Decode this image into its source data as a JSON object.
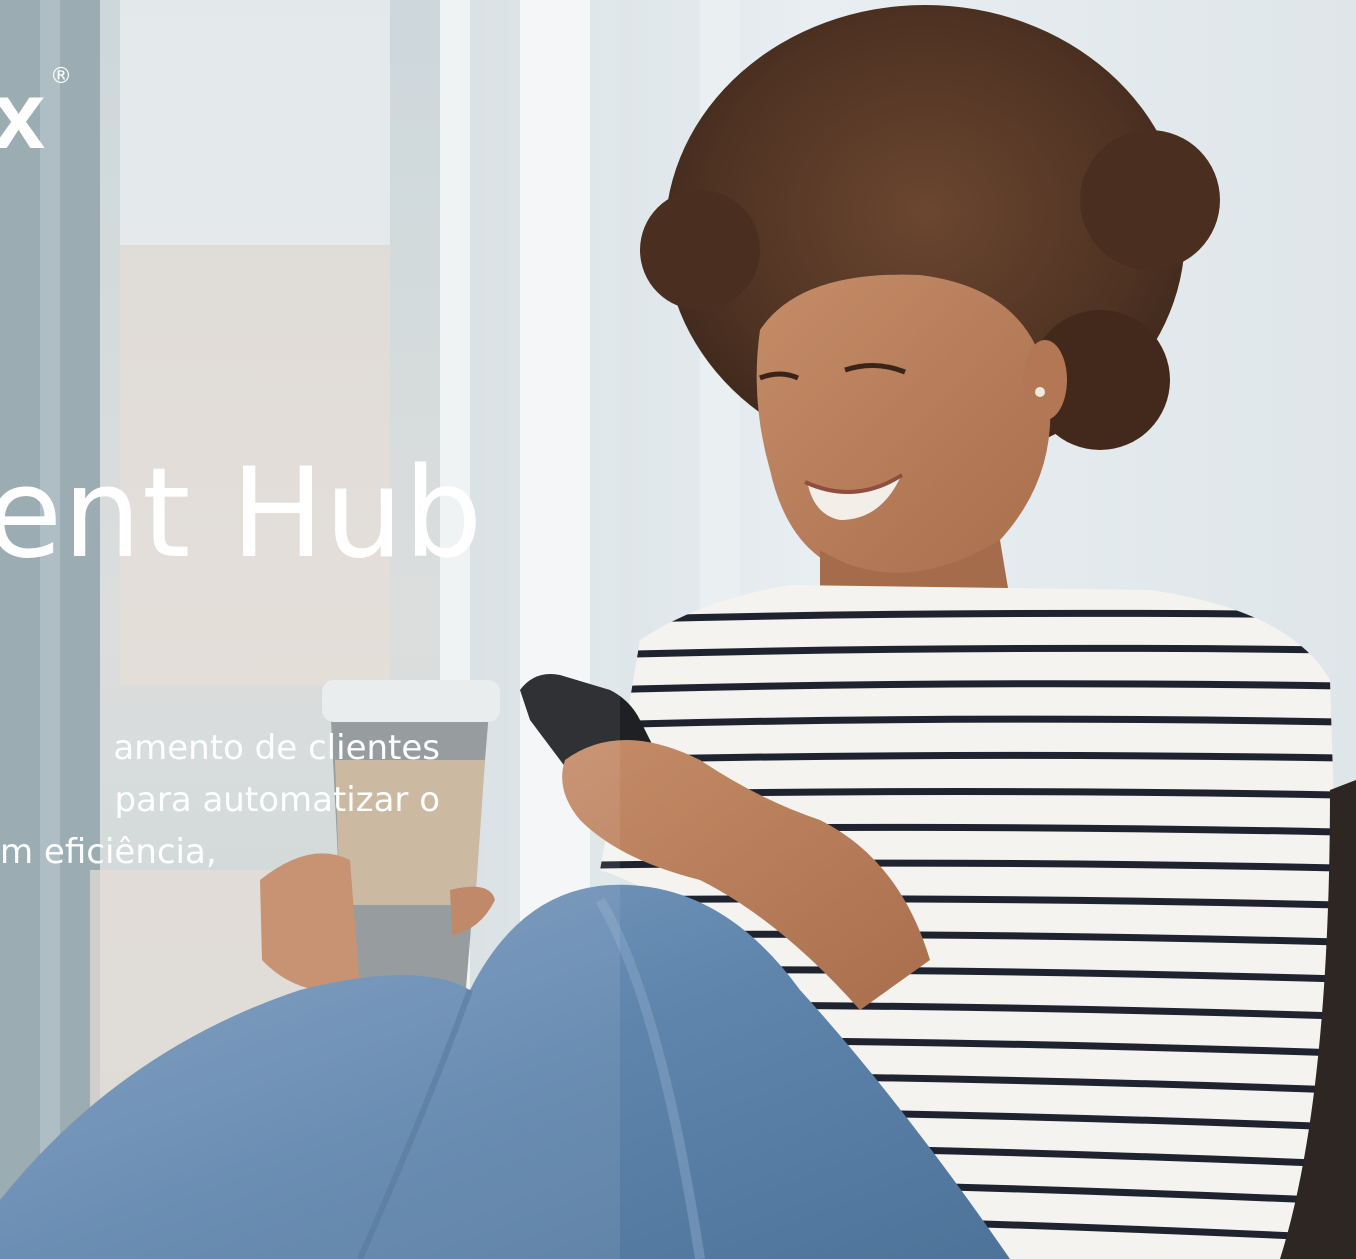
{
  "logo": {
    "text": "x",
    "registered_mark": "®"
  },
  "hero": {
    "headline": "ent Hub",
    "description_lines": [
      "amento de clientes",
      "para automatizar o",
      "m eficiência,"
    ]
  },
  "colors": {
    "text": "#ffffff",
    "window_light": "#e6ecef",
    "frame": "#8a9ba3",
    "stripe": "#1f2330",
    "denim": "#5f85ad",
    "hair": "#5a3a26",
    "skin": "#b9805e",
    "cup_sleeve": "#c7b49b",
    "cup_body": "#8f9597"
  },
  "icons": {
    "photo": "woman-with-phone-photo"
  }
}
